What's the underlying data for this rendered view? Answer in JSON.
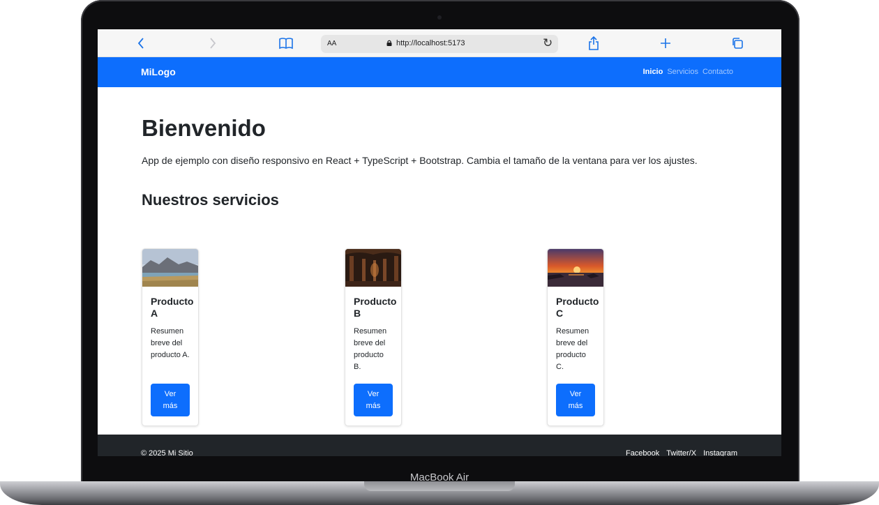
{
  "device_label": "MacBook Air",
  "browser": {
    "text_size_label": "AA",
    "url": "http://localhost:5173"
  },
  "navbar": {
    "brand": "MiLogo",
    "links": [
      "Inicio",
      "Servicios",
      "Contacto"
    ],
    "active_index": 0
  },
  "hero": {
    "title": "Bienvenido",
    "lead": "App de ejemplo con diseño responsivo en React + TypeScript + Bootstrap. Cambia el tamaño de la ventana para ver los ajustes."
  },
  "services": {
    "heading": "Nuestros servicios",
    "cards": [
      {
        "title": "Producto A",
        "text": "Resumen breve del producto A.",
        "button": "Ver más",
        "image": "mountain-lake-landscape"
      },
      {
        "title": "Producto B",
        "text": "Resumen breve del producto B.",
        "button": "Ver más",
        "image": "arched-corridor"
      },
      {
        "title": "Producto C",
        "text": "Resumen breve del producto C.",
        "button": "Ver más",
        "image": "sunset-over-sea"
      }
    ]
  },
  "footer": {
    "copyright": "© 2025 Mi Sitio",
    "links": [
      "Facebook",
      "Twitter/X",
      "Instagram"
    ]
  },
  "colors": {
    "primary": "#0d6efd",
    "footer_bg": "#212529",
    "text": "#212529"
  }
}
